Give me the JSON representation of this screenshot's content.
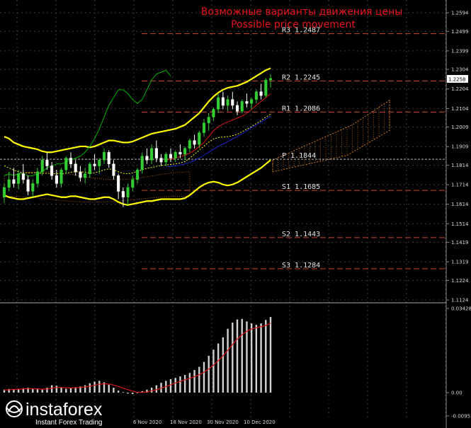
{
  "header": {
    "title_ru": "Возможные варианты движения цены",
    "title_en": "Possible price movement"
  },
  "chart_data": [
    {
      "type": "candlestick",
      "panel": "price",
      "y_ticks": [
        "1.2594",
        "1.2499",
        "1.2399",
        "1.2304",
        "1.2204",
        "1.2104",
        "1.2009",
        "1.1909",
        "1.1814",
        "1.1714",
        "1.1614",
        "1.1514",
        "1.1419",
        "1.1319",
        "1.1224",
        "1.1124"
      ],
      "ylim": [
        1.1124,
        1.2634
      ],
      "current_price": "1.2258",
      "levels": [
        {
          "label": "R3",
          "value": "1.2487"
        },
        {
          "label": "R2",
          "value": "1.2245"
        },
        {
          "label": "R1",
          "value": "1.2086"
        },
        {
          "label": "P",
          "value": "1.1844"
        },
        {
          "label": "S1",
          "value": "1.1685"
        },
        {
          "label": "S2",
          "value": "1.1443"
        },
        {
          "label": "S3",
          "value": "1.1284"
        }
      ],
      "candles": [
        [
          1.165,
          1.172,
          1.162,
          1.17
        ],
        [
          1.17,
          1.178,
          1.168,
          1.174
        ],
        [
          1.174,
          1.18,
          1.17,
          1.172
        ],
        [
          1.172,
          1.179,
          1.169,
          1.177
        ],
        [
          1.177,
          1.182,
          1.172,
          1.174
        ],
        [
          1.174,
          1.176,
          1.166,
          1.168
        ],
        [
          1.168,
          1.174,
          1.165,
          1.172
        ],
        [
          1.172,
          1.18,
          1.17,
          1.178
        ],
        [
          1.178,
          1.186,
          1.176,
          1.184
        ],
        [
          1.184,
          1.188,
          1.179,
          1.181
        ],
        [
          1.181,
          1.183,
          1.174,
          1.176
        ],
        [
          1.176,
          1.179,
          1.17,
          1.172
        ],
        [
          1.172,
          1.18,
          1.17,
          1.179
        ],
        [
          1.179,
          1.186,
          1.177,
          1.185
        ],
        [
          1.185,
          1.188,
          1.18,
          1.182
        ],
        [
          1.182,
          1.184,
          1.176,
          1.178
        ],
        [
          1.178,
          1.181,
          1.173,
          1.175
        ],
        [
          1.175,
          1.18,
          1.172,
          1.177
        ],
        [
          1.177,
          1.183,
          1.175,
          1.182
        ],
        [
          1.182,
          1.187,
          1.179,
          1.181
        ],
        [
          1.181,
          1.185,
          1.177,
          1.184
        ],
        [
          1.184,
          1.19,
          1.182,
          1.188
        ],
        [
          1.188,
          1.189,
          1.18,
          1.182
        ],
        [
          1.182,
          1.184,
          1.174,
          1.176
        ],
        [
          1.176,
          1.177,
          1.164,
          1.168
        ],
        [
          1.168,
          1.17,
          1.16,
          1.165
        ],
        [
          1.165,
          1.172,
          1.161,
          1.17
        ],
        [
          1.17,
          1.176,
          1.168,
          1.174
        ],
        [
          1.174,
          1.18,
          1.172,
          1.179
        ],
        [
          1.179,
          1.188,
          1.177,
          1.186
        ],
        [
          1.186,
          1.19,
          1.182,
          1.184
        ],
        [
          1.184,
          1.192,
          1.182,
          1.19
        ],
        [
          1.19,
          1.194,
          1.183,
          1.185
        ],
        [
          1.185,
          1.187,
          1.181,
          1.183
        ],
        [
          1.183,
          1.188,
          1.181,
          1.187
        ],
        [
          1.187,
          1.19,
          1.183,
          1.185
        ],
        [
          1.185,
          1.189,
          1.183,
          1.188
        ],
        [
          1.188,
          1.192,
          1.185,
          1.187
        ],
        [
          1.187,
          1.191,
          1.184,
          1.19
        ],
        [
          1.19,
          1.195,
          1.188,
          1.194
        ],
        [
          1.194,
          1.197,
          1.19,
          1.192
        ],
        [
          1.192,
          1.199,
          1.19,
          1.198
        ],
        [
          1.198,
          1.205,
          1.196,
          1.203
        ],
        [
          1.203,
          1.208,
          1.199,
          1.206
        ],
        [
          1.206,
          1.211,
          1.204,
          1.21
        ],
        [
          1.21,
          1.218,
          1.208,
          1.216
        ],
        [
          1.216,
          1.219,
          1.21,
          1.212
        ],
        [
          1.212,
          1.217,
          1.209,
          1.215
        ],
        [
          1.215,
          1.219,
          1.21,
          1.212
        ],
        [
          1.212,
          1.214,
          1.207,
          1.209
        ],
        [
          1.209,
          1.215,
          1.208,
          1.214
        ],
        [
          1.214,
          1.218,
          1.211,
          1.213
        ],
        [
          1.213,
          1.216,
          1.21,
          1.215
        ],
        [
          1.215,
          1.22,
          1.213,
          1.219
        ],
        [
          1.219,
          1.223,
          1.215,
          1.217
        ],
        [
          1.217,
          1.226,
          1.216,
          1.225
        ],
        [
          1.225,
          1.228,
          1.221,
          1.2258
        ]
      ],
      "bollinger_upper": [
        1.196,
        1.195,
        1.193,
        1.192,
        1.191,
        1.1905,
        1.19,
        1.1895,
        1.1885,
        1.188,
        1.188,
        1.1885,
        1.189,
        1.1895,
        1.19,
        1.1905,
        1.191,
        1.191,
        1.1905,
        1.191,
        1.192,
        1.193,
        1.194,
        1.194,
        1.1935,
        1.193,
        1.193,
        1.1935,
        1.1945,
        1.1955,
        1.1965,
        1.1975,
        1.198,
        1.1985,
        1.199,
        1.1995,
        1.2,
        1.201,
        1.202,
        1.204,
        1.206,
        1.208,
        1.211,
        1.214,
        1.2165,
        1.2185,
        1.22,
        1.221,
        1.2215,
        1.222,
        1.223,
        1.224,
        1.2255,
        1.227,
        1.2285,
        1.23,
        1.231
      ],
      "bollinger_lower": [
        1.166,
        1.165,
        1.1645,
        1.164,
        1.164,
        1.1645,
        1.165,
        1.1655,
        1.166,
        1.1665,
        1.166,
        1.1655,
        1.165,
        1.165,
        1.1655,
        1.1655,
        1.165,
        1.1645,
        1.164,
        1.164,
        1.1645,
        1.165,
        1.165,
        1.164,
        1.1625,
        1.1615,
        1.161,
        1.1615,
        1.162,
        1.1625,
        1.163,
        1.163,
        1.1635,
        1.164,
        1.164,
        1.164,
        1.164,
        1.164,
        1.1645,
        1.166,
        1.168,
        1.17,
        1.1715,
        1.1725,
        1.173,
        1.1725,
        1.1715,
        1.171,
        1.1715,
        1.1725,
        1.174,
        1.1755,
        1.177,
        1.1785,
        1.18,
        1.182,
        1.184
      ],
      "bollinger_mid": [
        1.181,
        1.18,
        1.1788,
        1.178,
        1.1775,
        1.1775,
        1.1775,
        1.1775,
        1.1772,
        1.1772,
        1.177,
        1.177,
        1.177,
        1.1772,
        1.1778,
        1.178,
        1.178,
        1.1778,
        1.1772,
        1.1775,
        1.1782,
        1.179,
        1.1795,
        1.179,
        1.178,
        1.1772,
        1.177,
        1.1775,
        1.1782,
        1.179,
        1.1798,
        1.1802,
        1.1808,
        1.1812,
        1.1815,
        1.1818,
        1.182,
        1.1825,
        1.1832,
        1.185,
        1.187,
        1.189,
        1.1912,
        1.1932,
        1.1948,
        1.1955,
        1.1958,
        1.196,
        1.1965,
        1.1972,
        1.1985,
        1.1998,
        1.2012,
        1.2028,
        1.2042,
        1.206,
        1.2075
      ],
      "line_green": [
        1.176,
        1.177,
        1.176,
        1.177,
        1.177,
        1.176,
        1.176,
        1.177,
        1.178,
        1.18,
        1.181,
        1.182,
        1.182,
        1.183,
        1.184,
        1.185,
        1.186,
        1.188,
        1.191,
        1.195,
        1.2,
        1.206,
        1.212,
        1.216,
        1.22,
        1.22,
        1.218,
        1.215,
        1.213,
        1.215,
        1.22,
        1.225,
        1.228,
        1.229,
        1.23,
        1.227,
        null,
        null,
        null,
        null,
        null,
        null,
        null,
        null,
        null,
        null,
        null,
        null,
        null,
        null,
        null,
        null,
        null,
        null,
        null,
        null,
        null
      ],
      "line_red": [
        null,
        null,
        null,
        null,
        null,
        null,
        null,
        null,
        null,
        null,
        null,
        null,
        null,
        null,
        null,
        null,
        null,
        null,
        null,
        null,
        null,
        null,
        null,
        null,
        null,
        null,
        null,
        null,
        null,
        null,
        null,
        null,
        null,
        null,
        1.184,
        1.1845,
        1.185,
        1.1858,
        1.1865,
        1.1875,
        1.189,
        1.191,
        1.193,
        1.196,
        1.199,
        1.201,
        1.2025,
        1.2035,
        1.2045,
        1.2055,
        1.2065,
        1.208,
        1.21,
        1.212,
        1.214,
        1.216,
        1.218
      ],
      "line_blue": [
        null,
        null,
        null,
        null,
        null,
        null,
        null,
        null,
        null,
        null,
        null,
        null,
        null,
        null,
        null,
        null,
        null,
        null,
        null,
        null,
        null,
        null,
        null,
        null,
        null,
        null,
        null,
        null,
        null,
        null,
        null,
        null,
        null,
        null,
        1.1805,
        1.1808,
        1.181,
        1.1815,
        1.182,
        1.1828,
        1.1838,
        1.185,
        1.1865,
        1.188,
        1.1895,
        1.191,
        1.1922,
        1.1935,
        1.1948,
        1.196,
        1.1975,
        1.199,
        1.2005,
        1.202,
        1.2035,
        1.205,
        1.2065
      ]
    },
    {
      "type": "bar",
      "panel": "indicator",
      "y_ticks": [
        "0.03428",
        "0.00",
        "-0.00951"
      ],
      "ylim": [
        -0.00951,
        0.03428
      ],
      "values": [
        0.0012,
        0.0015,
        0.0013,
        0.0016,
        0.0018,
        0.002,
        0.0017,
        0.0014,
        0.0012,
        0.002,
        0.003,
        0.0028,
        0.002,
        0.0016,
        0.0018,
        0.0022,
        0.0025,
        0.003,
        0.0038,
        0.0045,
        0.0048,
        0.0042,
        0.0032,
        0.002,
        0.0008,
        0.0002,
        -0.0004,
        -0.0006,
        0.0,
        0.0006,
        0.0012,
        0.002,
        0.003,
        0.004,
        0.0048,
        0.0055,
        0.006,
        0.0066,
        0.0072,
        0.008,
        0.0092,
        0.0105,
        0.0125,
        0.015,
        0.0175,
        0.02,
        0.0225,
        0.026,
        0.0285,
        0.0298,
        0.03,
        0.029,
        0.0282,
        0.0276,
        0.0282,
        0.0296,
        0.0308
      ],
      "signal": [
        0.001,
        0.0012,
        0.0013,
        0.0014,
        0.0015,
        0.0016,
        0.0016,
        0.0015,
        0.0014,
        0.0015,
        0.0018,
        0.0021,
        0.0021,
        0.002,
        0.0019,
        0.002,
        0.0021,
        0.0023,
        0.0026,
        0.003,
        0.0034,
        0.0036,
        0.0035,
        0.0031,
        0.0025,
        0.0018,
        0.0012,
        0.0006,
        0.0002,
        0.0001,
        0.0003,
        0.0007,
        0.0012,
        0.0018,
        0.0025,
        0.0032,
        0.0039,
        0.0046,
        0.0052,
        0.0058,
        0.0065,
        0.0073,
        0.0083,
        0.0096,
        0.0112,
        0.013,
        0.015,
        0.0172,
        0.0196,
        0.0218,
        0.0236,
        0.025,
        0.0259,
        0.0264,
        0.0268,
        0.0274,
        0.0282
      ]
    }
  ],
  "x_axis": {
    "labels": [
      "6 Nov 2020",
      "18 Nov 2020",
      "30 Nov 2020",
      "10 Dec 2020"
    ]
  },
  "colors": {
    "background": "#000000",
    "grid": "#3a3a3a",
    "bull_candle": "#32cd32",
    "bear_candle": "#ffffff",
    "bollinger": "#ffff00",
    "bollinger_mid": "#ffff00",
    "green_line": "#00b400",
    "red_line": "#dc1414",
    "blue_line": "#1e28c8",
    "level_line": "#c84628",
    "cloud": "#d2781e",
    "indicator_bar": "#d2d2d2",
    "signal_line": "#e01414",
    "title": "#e8141e"
  },
  "watermark": {
    "brand": "instaforex",
    "tagline": "Instant Forex Trading"
  }
}
